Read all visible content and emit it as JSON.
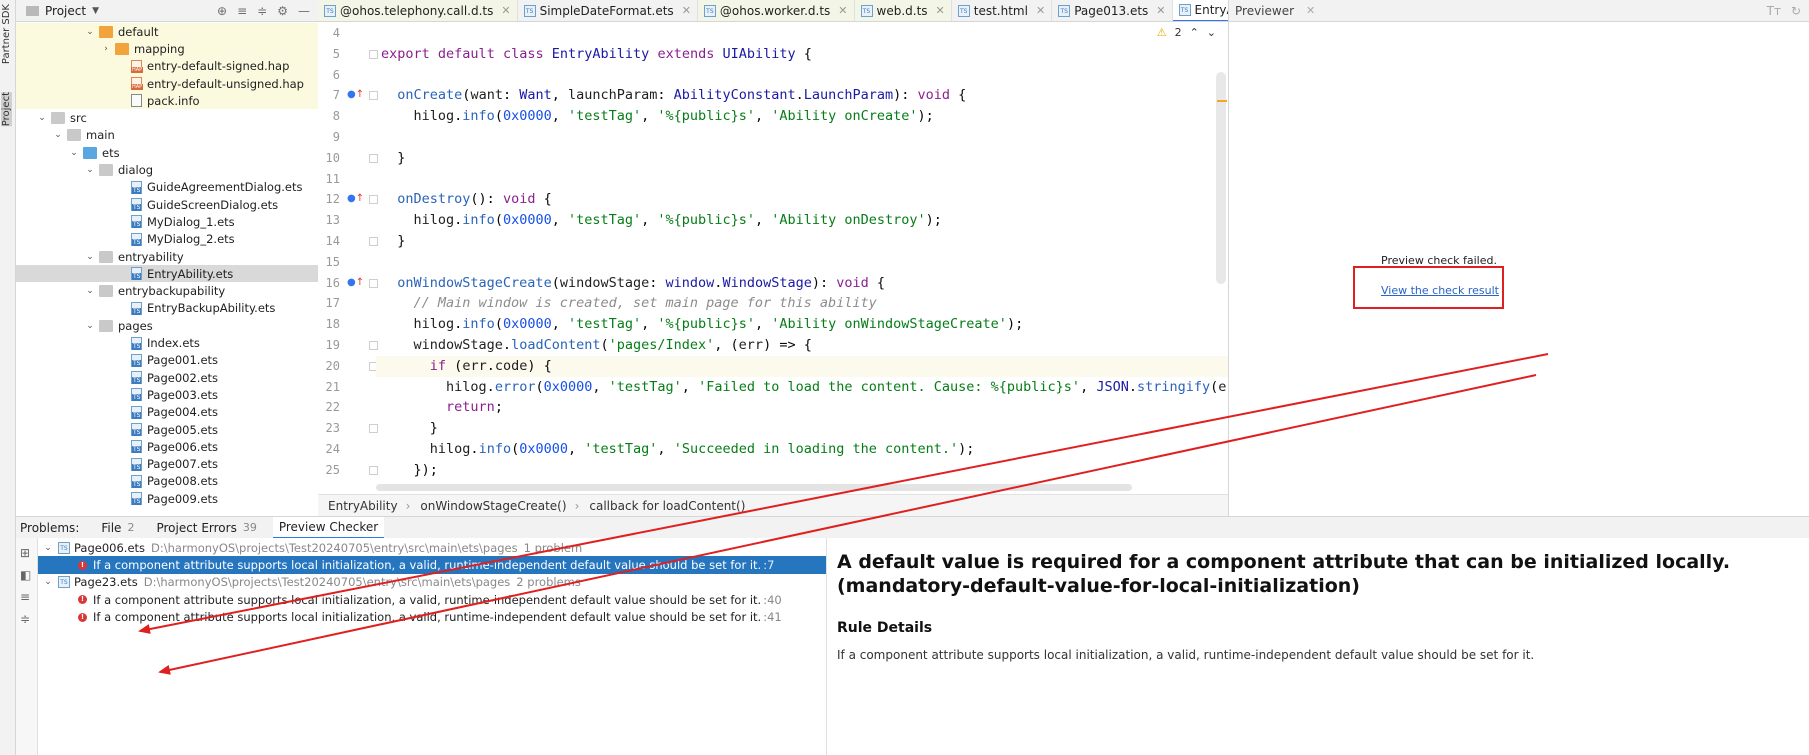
{
  "sidebar_strip": {
    "partner_sdk": "Partner SDK",
    "project": "Project"
  },
  "project_pane": {
    "title": "Project",
    "rows": [
      {
        "label": "default",
        "indent": 5,
        "icon": "folder-orange",
        "arrow": "down",
        "hl": true
      },
      {
        "label": "mapping",
        "indent": 6,
        "icon": "folder-orange",
        "arrow": "right",
        "hl": true
      },
      {
        "label": "entry-default-signed.hap",
        "indent": 7,
        "icon": "file-hap",
        "arrow": "",
        "hl": true
      },
      {
        "label": "entry-default-unsigned.hap",
        "indent": 7,
        "icon": "file-hap",
        "arrow": "",
        "hl": true
      },
      {
        "label": "pack.info",
        "indent": 7,
        "icon": "file-info",
        "arrow": "",
        "hl": true
      },
      {
        "label": "src",
        "indent": 2,
        "icon": "folder",
        "arrow": "down",
        "hl": false
      },
      {
        "label": "main",
        "indent": 3,
        "icon": "folder",
        "arrow": "down",
        "hl": false
      },
      {
        "label": "ets",
        "indent": 4,
        "icon": "folder-blue",
        "arrow": "down",
        "hl": false
      },
      {
        "label": "dialog",
        "indent": 5,
        "icon": "folder",
        "arrow": "down",
        "hl": false
      },
      {
        "label": "GuideAgreementDialog.ets",
        "indent": 7,
        "icon": "file-ts",
        "arrow": "",
        "hl": false
      },
      {
        "label": "GuideScreenDialog.ets",
        "indent": 7,
        "icon": "file-ts",
        "arrow": "",
        "hl": false
      },
      {
        "label": "MyDialog_1.ets",
        "indent": 7,
        "icon": "file-ts",
        "arrow": "",
        "hl": false
      },
      {
        "label": "MyDialog_2.ets",
        "indent": 7,
        "icon": "file-ts",
        "arrow": "",
        "hl": false
      },
      {
        "label": "entryability",
        "indent": 5,
        "icon": "folder",
        "arrow": "down",
        "hl": false
      },
      {
        "label": "EntryAbility.ets",
        "indent": 7,
        "icon": "file-ts",
        "arrow": "",
        "hl": false,
        "sel": true
      },
      {
        "label": "entrybackupability",
        "indent": 5,
        "icon": "folder",
        "arrow": "down",
        "hl": false
      },
      {
        "label": "EntryBackupAbility.ets",
        "indent": 7,
        "icon": "file-ts",
        "arrow": "",
        "hl": false
      },
      {
        "label": "pages",
        "indent": 5,
        "icon": "folder",
        "arrow": "down",
        "hl": false
      },
      {
        "label": "Index.ets",
        "indent": 7,
        "icon": "file-ts",
        "arrow": "",
        "hl": false
      },
      {
        "label": "Page001.ets",
        "indent": 7,
        "icon": "file-ts",
        "arrow": "",
        "hl": false
      },
      {
        "label": "Page002.ets",
        "indent": 7,
        "icon": "file-ts",
        "arrow": "",
        "hl": false
      },
      {
        "label": "Page003.ets",
        "indent": 7,
        "icon": "file-ts",
        "arrow": "",
        "hl": false
      },
      {
        "label": "Page004.ets",
        "indent": 7,
        "icon": "file-ts",
        "arrow": "",
        "hl": false
      },
      {
        "label": "Page005.ets",
        "indent": 7,
        "icon": "file-ts",
        "arrow": "",
        "hl": false
      },
      {
        "label": "Page006.ets",
        "indent": 7,
        "icon": "file-ts",
        "arrow": "",
        "hl": false
      },
      {
        "label": "Page007.ets",
        "indent": 7,
        "icon": "file-ts",
        "arrow": "",
        "hl": false
      },
      {
        "label": "Page008.ets",
        "indent": 7,
        "icon": "file-ts",
        "arrow": "",
        "hl": false
      },
      {
        "label": "Page009.ets",
        "indent": 7,
        "icon": "file-ts",
        "arrow": "",
        "hl": false
      }
    ]
  },
  "editor_tabs": [
    {
      "label": "@ohos.telephony.call.d.ts",
      "active": false,
      "tinted": true
    },
    {
      "label": "SimpleDateFormat.ets",
      "active": false,
      "tinted": false
    },
    {
      "label": "@ohos.worker.d.ts",
      "active": false,
      "tinted": true
    },
    {
      "label": "web.d.ts",
      "active": false,
      "tinted": true
    },
    {
      "label": "test.html",
      "active": false,
      "tinted": false
    },
    {
      "label": "Page013.ets",
      "active": false,
      "tinted": false
    },
    {
      "label": "EntryAbility.ets",
      "active": true,
      "tinted": false
    }
  ],
  "editor": {
    "warning_count": "2",
    "line_numbers": [
      "4",
      "5",
      "6",
      "7",
      "8",
      "9",
      "10",
      "11",
      "12",
      "13",
      "14",
      "15",
      "16",
      "17",
      "18",
      "19",
      "20",
      "21",
      "22",
      "23",
      "24",
      "25"
    ],
    "lines": [
      "",
      "export default class EntryAbility extends UIAbility {",
      "",
      "  onCreate(want: Want, launchParam: AbilityConstant.LaunchParam): void {",
      "    hilog.info(0x0000, 'testTag', '%{public}s', 'Ability onCreate');",
      "",
      "  }",
      "",
      "  onDestroy(): void {",
      "    hilog.info(0x0000, 'testTag', '%{public}s', 'Ability onDestroy');",
      "  }",
      "",
      "  onWindowStageCreate(windowStage: window.WindowStage): void {",
      "    // Main window is created, set main page for this ability",
      "    hilog.info(0x0000, 'testTag', '%{public}s', 'Ability onWindowStageCreate');",
      "    windowStage.loadContent('pages/Index', (err) => {",
      "      if (err.code) {",
      "        hilog.error(0x0000, 'testTag', 'Failed to load the content. Cause: %{public}s', JSON.stringify(err) ?",
      "        return;",
      "      }",
      "      hilog.info(0x0000, 'testTag', 'Succeeded in loading the content.');",
      "    });"
    ]
  },
  "breadcrumb": [
    "EntryAbility",
    "onWindowStageCreate()",
    "callback for loadContent()"
  ],
  "previewer": {
    "title": "Previewer",
    "failed_text": "Preview check failed.",
    "link_text": "View the check result"
  },
  "problems": {
    "label": "Problems:",
    "tabs": [
      {
        "label": "File",
        "count": "2"
      },
      {
        "label": "Project Errors",
        "count": "39"
      },
      {
        "label": "Preview Checker",
        "count": ""
      }
    ],
    "rows": [
      {
        "type": "file",
        "name": "Page006.ets",
        "path": "D:\\harmonyOS\\projects\\Test20240705\\entry\\src\\main\\ets\\pages",
        "count": "1 problem"
      },
      {
        "type": "issue",
        "text": "If a component attribute supports local initialization, a valid, runtime-independent default value should be set for it.",
        "loc": ":7",
        "sel": true
      },
      {
        "type": "file",
        "name": "Page23.ets",
        "path": "D:\\harmonyOS\\projects\\Test20240705\\entry\\src\\main\\ets\\pages",
        "count": "2 problems"
      },
      {
        "type": "issue",
        "text": "If a component attribute supports local initialization, a valid, runtime-independent default value should be set for it.",
        "loc": ":40",
        "sel": false
      },
      {
        "type": "issue",
        "text": "If a component attribute supports local initialization, a valid, runtime-independent default value should be set for it.",
        "loc": ":41",
        "sel": false
      }
    ],
    "detail_title": "A default value is required for a component attribute that can be initialized locally. (mandatory-default-value-for-local-initialization)",
    "detail_subtitle": "Rule Details",
    "detail_text": "If a component attribute supports local initialization, a valid, runtime-independent default value should be set for it."
  },
  "colors": {
    "accent": "#3574f0",
    "selection": "#2675bf",
    "annotation": "#e02020",
    "highlight_row": "#fbf9de"
  }
}
